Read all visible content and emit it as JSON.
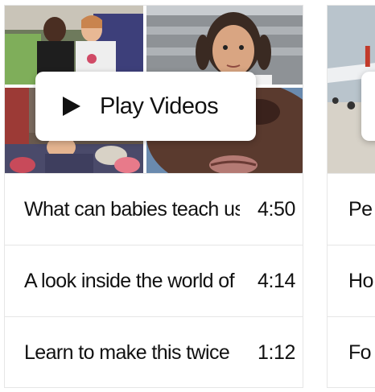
{
  "main_card": {
    "play_label": "Play Videos",
    "videos": [
      {
        "title": "What can babies teach us",
        "duration": "4:50"
      },
      {
        "title": "A look inside the world of",
        "duration": "4:14"
      },
      {
        "title": "Learn to make this twice",
        "duration": "1:12"
      }
    ]
  },
  "next_card": {
    "rows": [
      "Pe",
      "Ho",
      "Fo"
    ]
  },
  "colors": {
    "text": "#111111",
    "border": "#e6e6e6",
    "overlay": "#ffffff"
  }
}
